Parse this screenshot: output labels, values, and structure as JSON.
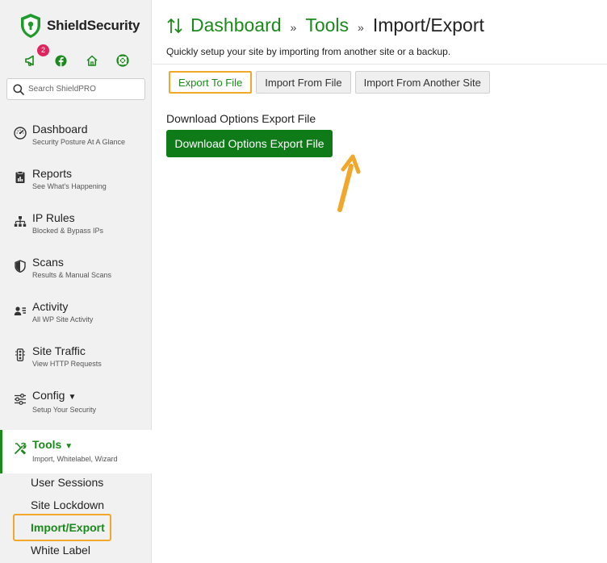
{
  "app": {
    "logo_text": "ShieldSecurity",
    "notification_count": "2",
    "search_placeholder": "Search ShieldPRO"
  },
  "sidebar": {
    "items": [
      {
        "title": "Dashboard",
        "subtitle": "Security Posture At A Glance",
        "icon": "dashboard-gauge-icon"
      },
      {
        "title": "Reports",
        "subtitle": "See What's Happening",
        "icon": "report-icon"
      },
      {
        "title": "IP Rules",
        "subtitle": "Blocked & Bypass IPs",
        "icon": "ip-network-icon"
      },
      {
        "title": "Scans",
        "subtitle": "Results & Manual Scans",
        "icon": "shield-half-icon"
      },
      {
        "title": "Activity",
        "subtitle": "All WP Site Activity",
        "icon": "person-lines-icon"
      },
      {
        "title": "Site Traffic",
        "subtitle": "View HTTP Requests",
        "icon": "traffic-light-icon"
      },
      {
        "title": "Config",
        "subtitle": "Setup Your Security",
        "icon": "sliders-icon"
      },
      {
        "title": "Tools",
        "subtitle": "Import, Whitelabel, Wizard",
        "icon": "tools-icon"
      }
    ],
    "tools_subitems": [
      "User Sessions",
      "Site Lockdown",
      "Import/Export",
      "White Label"
    ]
  },
  "header": {
    "breadcrumb": [
      "Dashboard",
      "Tools",
      "Import/Export"
    ],
    "separator": "»",
    "subtitle": "Quickly setup your site by importing from another site or a backup."
  },
  "tabs": [
    "Export To File",
    "Import From File",
    "Import From Another Site"
  ],
  "content": {
    "section_label": "Download Options Export File",
    "download_button": "Download Options Export File"
  },
  "colors": {
    "accent_green": "#1a8a1a",
    "button_green": "#0e7a18",
    "highlight_orange": "#f0a72a",
    "badge_red": "#e0245e"
  }
}
